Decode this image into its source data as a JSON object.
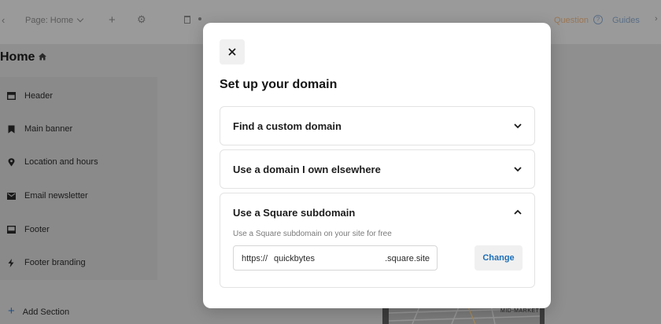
{
  "topbar": {
    "page_selector": "Page: Home",
    "right_link_orange": "Question",
    "help_glyph": "?",
    "guides": "Guides"
  },
  "sidebar": {
    "page_title": "Home",
    "sections": [
      {
        "label": "Header",
        "icon": "header-icon"
      },
      {
        "label": "Main banner",
        "icon": "bookmark-icon"
      },
      {
        "label": "Location and hours",
        "icon": "location-pin-icon"
      },
      {
        "label": "Email newsletter",
        "icon": "envelope-icon"
      },
      {
        "label": "Footer",
        "icon": "footer-icon"
      },
      {
        "label": "Footer branding",
        "icon": "lightning-icon"
      }
    ],
    "add_section": "Add Section"
  },
  "preview": {
    "map_label": "MID-MARKET"
  },
  "modal": {
    "title": "Set up your domain",
    "accordion": [
      {
        "title": "Find a custom domain",
        "expanded": false
      },
      {
        "title": "Use a domain I own elsewhere",
        "expanded": false
      },
      {
        "title": "Use a Square subdomain",
        "expanded": true
      }
    ],
    "subdomain": {
      "description": "Use a Square subdomain on your site for free",
      "prefix": "https://",
      "value": "quickbytes",
      "suffix": ".square.site",
      "change_label": "Change"
    }
  },
  "colors": {
    "overlay": "#8f8f8f",
    "modal_bg": "#ffffff",
    "link_blue": "#1d6fb8",
    "button_bg": "#f0f0f0"
  }
}
